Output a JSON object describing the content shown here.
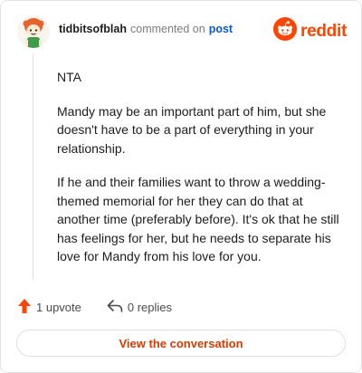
{
  "header": {
    "username": "tidbitsofblah",
    "action_text": "commented on",
    "post_link": "post",
    "brand_name": "reddit"
  },
  "comment": {
    "paragraphs": [
      "NTA",
      "Mandy may be an important part of him, but she doesn't have to be a part of everything in your relationship.",
      "If he and their families want to throw a wedding-themed memorial for her they can do that at another time (preferably before). It's ok that he still has feelings for her, but he needs to separate his love for Mandy from his love for you."
    ]
  },
  "actions": {
    "upvote_label": "1 upvote",
    "replies_label": "0 replies"
  },
  "cta": {
    "label": "View the conversation"
  },
  "colors": {
    "accent": "#ff4500",
    "link": "#0a5ad1",
    "cta_text": "#d93a00"
  },
  "icons": {
    "avatar": "avatar",
    "brand": "reddit-snoo-icon",
    "upvote": "upvote-arrow-icon",
    "reply": "reply-arrow-icon"
  }
}
